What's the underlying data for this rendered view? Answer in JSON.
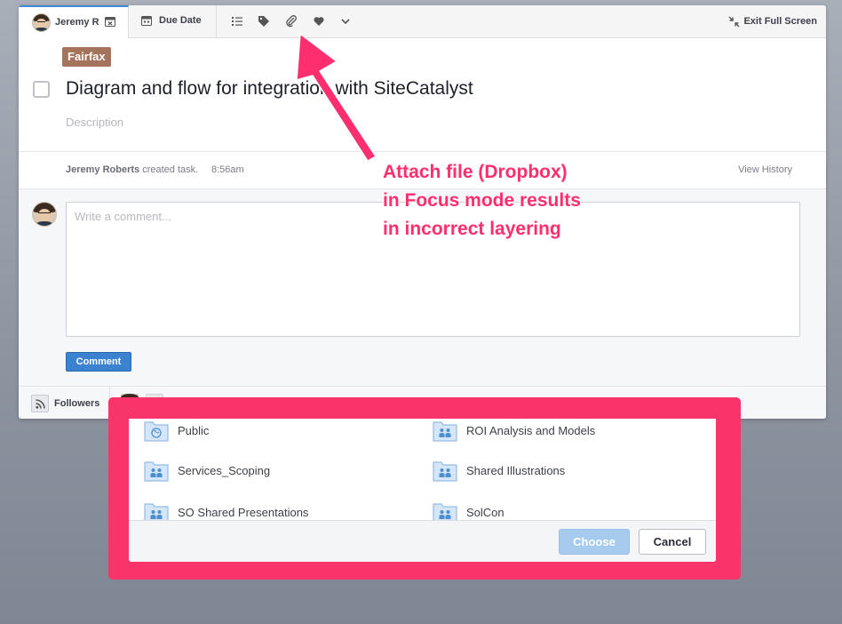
{
  "toolbar": {
    "assignee_name": "Jeremy R",
    "due_date_label": "Due Date",
    "exit_fullscreen_label": "Exit Full Screen",
    "icons": [
      "subtasks-icon",
      "tag-icon",
      "paperclip-icon",
      "heart-icon",
      "chevron-down-icon"
    ]
  },
  "task": {
    "tag": "Fairfax",
    "title": "Diagram and flow for integration with SiteCatalyst",
    "description_placeholder": "Description"
  },
  "activity": {
    "author": "Jeremy Roberts",
    "action": " created task.",
    "time": "8:56am",
    "view_history_label": "View History"
  },
  "comment": {
    "placeholder": "Write a comment...",
    "button_label": "Comment"
  },
  "followers": {
    "label": "Followers"
  },
  "chooser": {
    "folders": [
      {
        "name": "Public",
        "type": "public"
      },
      {
        "name": "ROI Analysis and Models",
        "type": "shared"
      },
      {
        "name": "Services_Scoping",
        "type": "shared"
      },
      {
        "name": "Shared Illustrations",
        "type": "shared"
      },
      {
        "name": "SO Shared Presentations",
        "type": "shared"
      },
      {
        "name": "SolCon",
        "type": "shared"
      }
    ],
    "choose_label": "Choose",
    "cancel_label": "Cancel"
  },
  "annotation": {
    "lines": [
      "Attach file (Dropbox)",
      "in Focus mode results",
      "in incorrect layering"
    ],
    "color": "#ff2e6e",
    "highlight_color": "#f8346a"
  }
}
